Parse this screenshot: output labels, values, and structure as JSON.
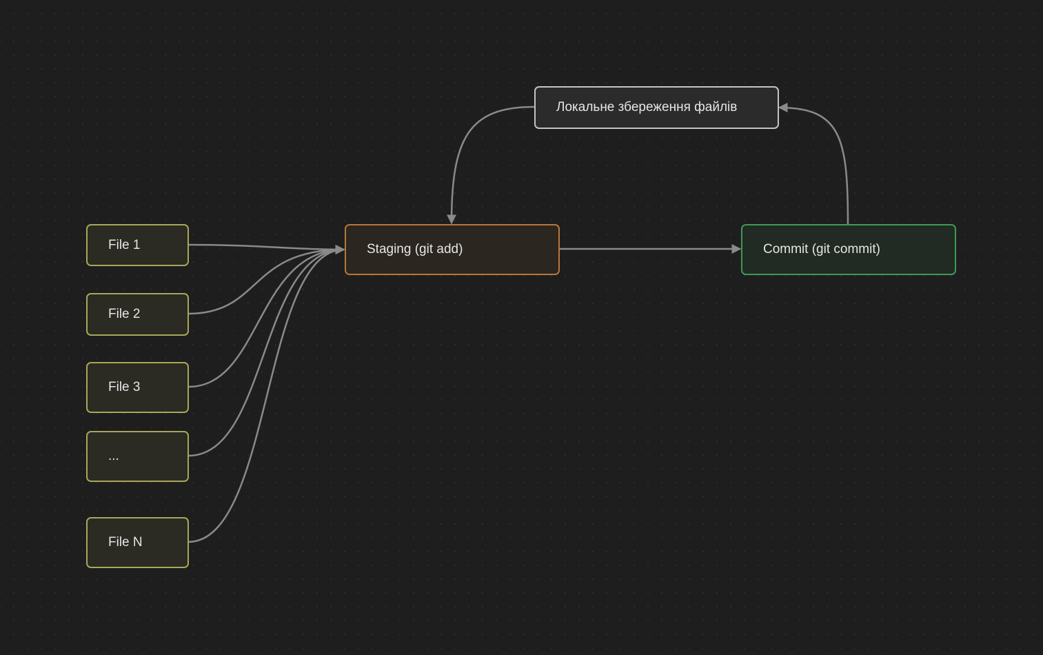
{
  "colors": {
    "background": "#1e1e1e",
    "edge": "#8a8a8a",
    "file_border": "#a8a85a",
    "staging_border": "#b8783a",
    "commit_border": "#3e9a58",
    "local_border": "#c4c4c4",
    "text": "#e6e6e6"
  },
  "nodes": {
    "file1": "File 1",
    "file2": "File 2",
    "file3": "File 3",
    "file_ellipsis": "...",
    "fileN": "File N",
    "staging": "Staging (git add)",
    "commit": "Commit (git commit)",
    "local": "Локальне збереження файлів"
  },
  "edges": [
    {
      "from": "file1",
      "to": "staging"
    },
    {
      "from": "file2",
      "to": "staging"
    },
    {
      "from": "file3",
      "to": "staging"
    },
    {
      "from": "file_ellipsis",
      "to": "staging"
    },
    {
      "from": "fileN",
      "to": "staging"
    },
    {
      "from": "staging",
      "to": "commit"
    },
    {
      "from": "commit",
      "to": "local"
    },
    {
      "from": "local",
      "to": "staging"
    }
  ]
}
